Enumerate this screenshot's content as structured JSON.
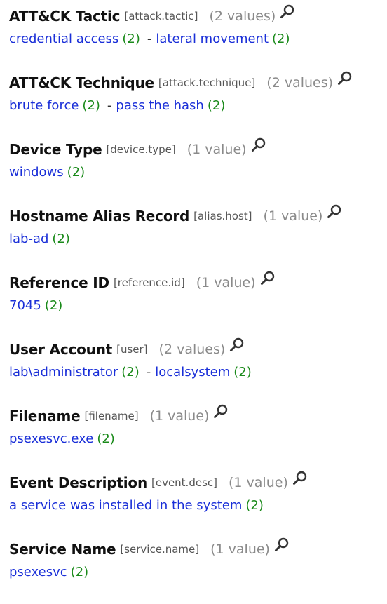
{
  "fields": [
    {
      "name": "ATT&CK Tactic",
      "key": "[attack.tactic]",
      "count": "(2 values)",
      "icon": "magnifier-icon",
      "values": [
        {
          "text": "credential access",
          "count": "(2)"
        },
        {
          "text": "lateral movement",
          "count": "(2)"
        }
      ]
    },
    {
      "name": "ATT&CK Technique",
      "key": "[attack.technique]",
      "count": "(2 values)",
      "icon": "magnifier-icon",
      "values": [
        {
          "text": "brute force",
          "count": "(2)"
        },
        {
          "text": "pass the hash",
          "count": "(2)"
        }
      ]
    },
    {
      "name": "Device Type",
      "key": "[device.type]",
      "count": "(1 value)",
      "icon": "magnifier-icon",
      "values": [
        {
          "text": "windows",
          "count": "(2)"
        }
      ]
    },
    {
      "name": "Hostname Alias Record",
      "key": "[alias.host]",
      "count": "(1 value)",
      "icon": "magnifier-icon",
      "values": [
        {
          "text": "lab-ad",
          "count": "(2)"
        }
      ]
    },
    {
      "name": "Reference ID",
      "key": "[reference.id]",
      "count": "(1 value)",
      "icon": "magnifier-icon",
      "values": [
        {
          "text": "7045",
          "count": "(2)"
        }
      ]
    },
    {
      "name": "User Account",
      "key": "[user]",
      "count": "(2 values)",
      "icon": "magnifier-icon",
      "values": [
        {
          "text": "lab\\administrator",
          "count": "(2)"
        },
        {
          "text": "localsystem",
          "count": "(2)"
        }
      ]
    },
    {
      "name": "Filename",
      "key": "[filename]",
      "count": "(1 value)",
      "icon": "magnifier-icon",
      "values": [
        {
          "text": "psexesvc.exe",
          "count": "(2)"
        }
      ]
    },
    {
      "name": "Event Description",
      "key": "[event.desc]",
      "count": "(1 value)",
      "icon": "magnifier-icon",
      "values": [
        {
          "text": "a service was installed in the system",
          "count": "(2)"
        }
      ]
    },
    {
      "name": "Service Name",
      "key": "[service.name]",
      "count": "(1 value)",
      "icon": "magnifier-icon",
      "values": [
        {
          "text": "psexesvc",
          "count": "(2)"
        }
      ]
    }
  ],
  "separator": "-",
  "colors": {
    "value_link": "#1a2fd8",
    "value_count": "#1a8a1a",
    "field_count": "#8a8a8a",
    "field_key": "#555555"
  }
}
